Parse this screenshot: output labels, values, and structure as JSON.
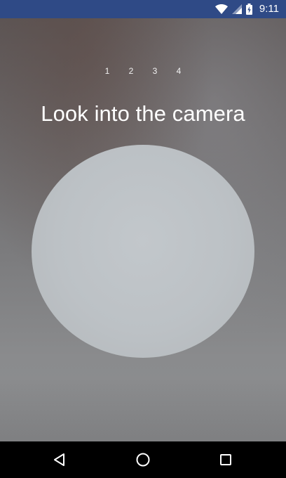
{
  "status_bar": {
    "time": "9:11",
    "background_color": "#2f4a86",
    "icons": [
      "wifi-icon",
      "cell-signal-icon",
      "battery-charging-icon"
    ]
  },
  "steps": [
    "1",
    "2",
    "3",
    "4"
  ],
  "prompt": {
    "title": "Look into the camera"
  },
  "nav_bar": {
    "buttons": [
      "back-icon",
      "home-icon",
      "recents-icon"
    ]
  }
}
